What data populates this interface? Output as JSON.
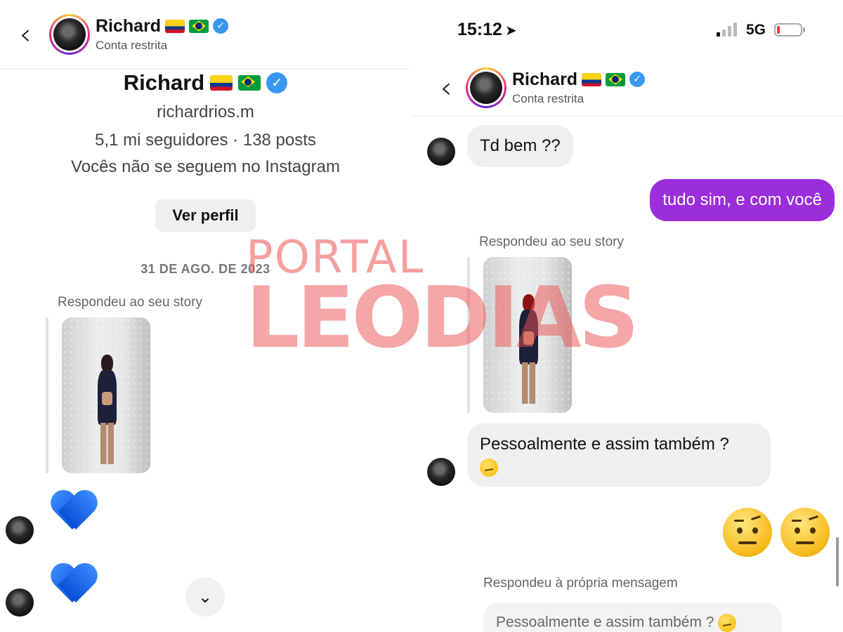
{
  "left": {
    "header": {
      "back_icon": "chevron-left-icon",
      "name": "Richard",
      "flags": [
        "colombia-flag",
        "brazil-flag"
      ],
      "verified_icon": "verified-badge-icon",
      "subtitle": "Conta restrita"
    },
    "profile": {
      "name": "Richard",
      "handle": "richardrios.m",
      "stats": "5,1 mi seguidores · 138 posts",
      "follow_status": "Vocês não se seguem no Instagram",
      "view_profile_label": "Ver perfil"
    },
    "date": "31 DE AGO. DE 2023",
    "story_reply_label": "Respondeu ao seu story",
    "messages": [
      {
        "type": "emoji",
        "emoji": "blue-heart"
      },
      {
        "type": "emoji",
        "emoji": "blue-heart"
      }
    ],
    "scroll_down_icon": "chevron-down-icon"
  },
  "right": {
    "status_bar": {
      "time": "15:12",
      "location_icon": "location-arrow-icon",
      "network": "5G",
      "signal_bars_active": 1,
      "battery_level": 0.1
    },
    "header": {
      "back_icon": "chevron-left-icon",
      "name": "Richard",
      "flags": [
        "colombia-flag",
        "brazil-flag"
      ],
      "verified_icon": "verified-badge-icon",
      "subtitle": "Conta restrita"
    },
    "messages": {
      "m1": "Td bem ??",
      "m2": "tudo sim, e com você",
      "story_reply_label": "Respondeu ao seu story",
      "m3": "Pessoalmente e assim também ?",
      "reactions": [
        "raised-eyebrow-emoji",
        "raised-eyebrow-emoji"
      ],
      "self_reply_label": "Respondeu à própria mensagem",
      "quoted": "Pessoalmente e assim também ?"
    }
  },
  "watermark": {
    "line1": "PORTAL",
    "line2": "LEODIAS"
  }
}
